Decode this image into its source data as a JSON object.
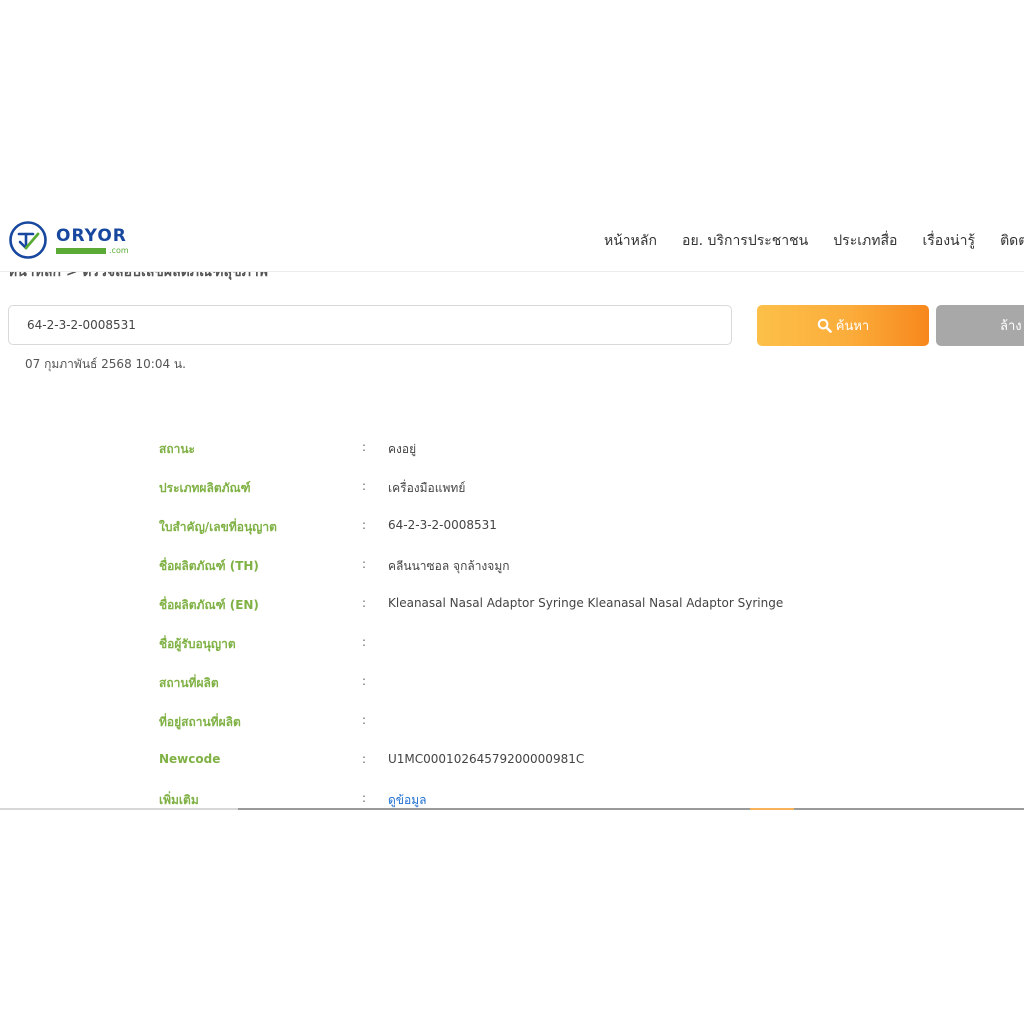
{
  "header": {
    "logo_text": "ORYOR",
    "logo_sub": ".com",
    "nav": [
      {
        "label": "หน้าหลัก"
      },
      {
        "label": "อย. บริการประชาชน"
      },
      {
        "label": "ประเภทสื่อ"
      },
      {
        "label": "เรื่องน่ารู้"
      },
      {
        "label": "ติดต่อ"
      }
    ]
  },
  "breadcrumb": "หน้าหลัก > ตรวจสอบเลขผลิตภัณฑ์สุขภาพ",
  "search": {
    "value": "64-2-3-2-0008531",
    "button_label": "ค้นหา",
    "clear_label": "ล้าง"
  },
  "timestamp": "07 กุมภาพันธ์ 2568 10:04 น.",
  "details": {
    "separator": ":",
    "rows": [
      {
        "label": "สถานะ",
        "value": "คงอยู่"
      },
      {
        "label": "ประเภทผลิตภัณฑ์",
        "value": "เครื่องมือแพทย์"
      },
      {
        "label": "ใบสำคัญ/เลขที่อนุญาต",
        "value": "64-2-3-2-0008531"
      },
      {
        "label": "ชื่อผลิตภัณฑ์ (TH)",
        "value": "คลีนนาซอล จุกล้างจมูก"
      },
      {
        "label": "ชื่อผลิตภัณฑ์ (EN)",
        "value": "Kleanasal Nasal Adaptor Syringe Kleanasal Nasal Adaptor Syringe"
      },
      {
        "label": "ชื่อผู้รับอนุญาต",
        "value": ""
      },
      {
        "label": "สถานที่ผลิต",
        "value": ""
      },
      {
        "label": "ที่อยู่สถานที่ผลิต",
        "value": ""
      },
      {
        "label": "Newcode",
        "value": "U1MC00010264579200000981C"
      },
      {
        "label": "เพิ่มเติม",
        "value": "ดูข้อมูล"
      }
    ]
  },
  "colors": {
    "label_green": "#7fb144",
    "search_orange": "#f7871d",
    "clear_gray": "#a8a8a8",
    "link_blue": "#1e6fd0",
    "logo_blue": "#17479e"
  }
}
